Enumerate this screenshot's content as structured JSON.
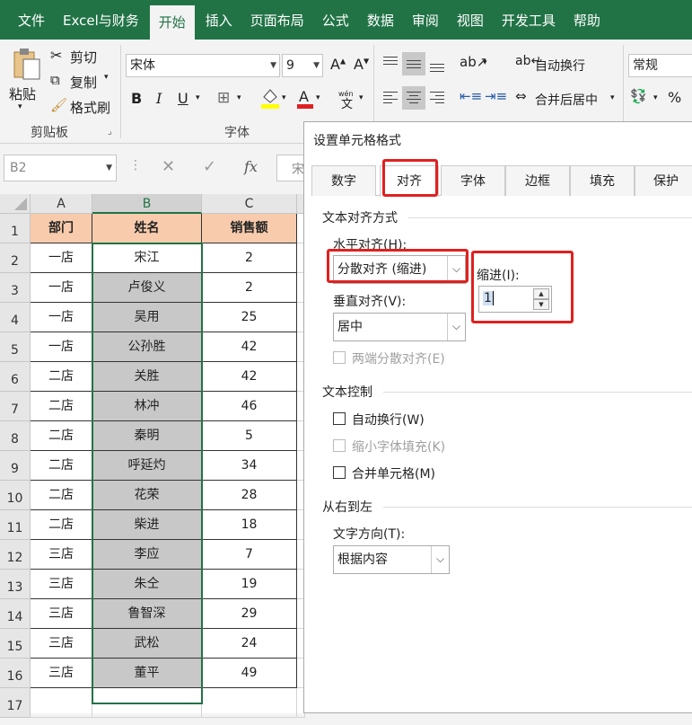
{
  "ribbon_tabs": [
    "文件",
    "Excel与财务",
    "开始",
    "插入",
    "页面布局",
    "公式",
    "数据",
    "审阅",
    "视图",
    "开发工具",
    "帮助"
  ],
  "clipboard": {
    "paste": "粘贴",
    "cut": "剪切",
    "copy": "复制",
    "format_painter": "格式刷",
    "group_label": "剪贴板"
  },
  "font": {
    "name": "宋体",
    "size": "9",
    "group_label": "字体",
    "bold": "B",
    "italic": "I",
    "underline": "U"
  },
  "alignment": {
    "wrap_text": "自动换行",
    "merge_center": "合并后居中"
  },
  "number": {
    "format": "常规",
    "percent": "%"
  },
  "formula_bar": {
    "name_box": "B2",
    "fx": "fx",
    "content_peek": "宋"
  },
  "columns": [
    "A",
    "B",
    "C"
  ],
  "rows": [
    "1",
    "2",
    "3",
    "4",
    "5",
    "6",
    "7",
    "8",
    "9",
    "10",
    "11",
    "12",
    "13",
    "14",
    "15",
    "16",
    "17"
  ],
  "table": {
    "headers": [
      "部门",
      "姓名",
      "销售额"
    ],
    "rows": [
      [
        "一店",
        "宋江",
        "2"
      ],
      [
        "一店",
        "卢俊义",
        "2"
      ],
      [
        "一店",
        "吴用",
        "25"
      ],
      [
        "一店",
        "公孙胜",
        "42"
      ],
      [
        "二店",
        "关胜",
        "42"
      ],
      [
        "二店",
        "林冲",
        "46"
      ],
      [
        "二店",
        "秦明",
        "5"
      ],
      [
        "二店",
        "呼延灼",
        "34"
      ],
      [
        "二店",
        "花荣",
        "28"
      ],
      [
        "二店",
        "柴进",
        "18"
      ],
      [
        "三店",
        "李应",
        "7"
      ],
      [
        "三店",
        "朱仝",
        "19"
      ],
      [
        "三店",
        "鲁智深",
        "29"
      ],
      [
        "三店",
        "武松",
        "24"
      ],
      [
        "三店",
        "董平",
        "49"
      ]
    ]
  },
  "dialog": {
    "title": "设置单元格格式",
    "tabs": [
      "数字",
      "对齐",
      "字体",
      "边框",
      "填充",
      "保护"
    ],
    "section_align": "文本对齐方式",
    "horizontal_label": "水平对齐(H):",
    "horizontal_value": "分散对齐 (缩进)",
    "indent_label": "缩进(I):",
    "indent_value": "1",
    "vertical_label": "垂直对齐(V):",
    "vertical_value": "居中",
    "justify_distributed": "两端分散对齐(E)",
    "section_control": "文本控制",
    "wrap_text": "自动换行(W)",
    "shrink_to_fit": "缩小字体填充(K)",
    "merge_cells": "合并单元格(M)",
    "section_rtl": "从右到左",
    "direction_label": "文字方向(T):",
    "direction_value": "根据内容"
  },
  "colors": {
    "excel_green": "#217346",
    "header_fill": "#f8cbad",
    "selected_fill": "#c8c8c8",
    "highlight": "#e02020"
  }
}
